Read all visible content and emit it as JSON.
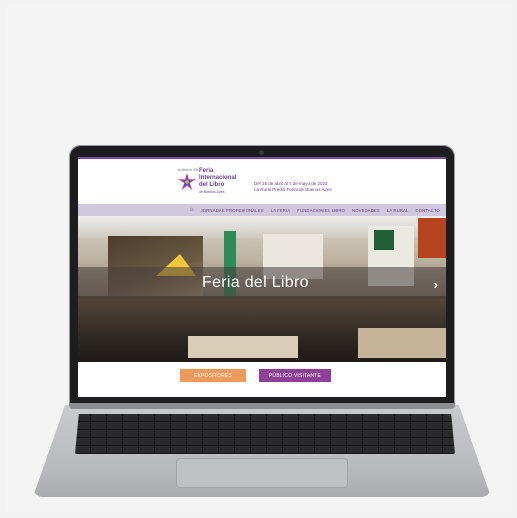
{
  "site": {
    "edition_small": "edición 46",
    "brand_line1": "Feria",
    "brand_line2": "Internacional",
    "brand_line3": "del Libro",
    "brand_sub": "de Buenos Aires",
    "dates_line1": "Del 18 de abril al 7 de mayo de 2022",
    "dates_line2": "La Rural Predio Ferial de Buenos Aires",
    "nav": {
      "home_icon": "home-icon",
      "items": [
        "JORNADAS PROFESIONALES",
        "LA FERIA",
        "FUNDACION EL LIBRO",
        "NOVEDADES",
        "LA RURAL",
        "CONTACTO"
      ]
    },
    "hero": {
      "caption": "Feria  del Libro",
      "next_icon": "chevron-right-icon"
    },
    "buttons": {
      "expositores": "EXPOSITORES",
      "publico": "PÚBLICO VISITANTE"
    }
  },
  "colors": {
    "brand_purple": "#6a3c8e",
    "nav_bg": "#cfc8df",
    "btn_orange": "#ee9a5c",
    "btn_purple": "#8e3f96"
  }
}
